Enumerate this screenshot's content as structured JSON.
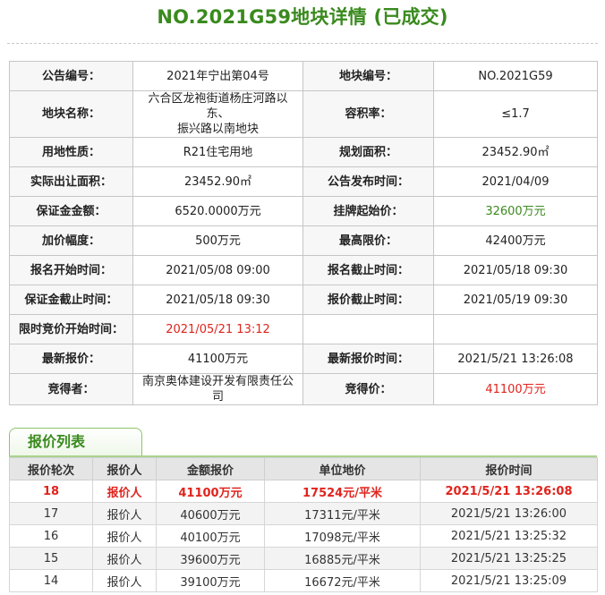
{
  "page_title": "NO.2021G59地块详情 (已成交)",
  "info": {
    "announcement_no_label": "公告编号：",
    "announcement_no": "2021年宁出第04号",
    "plot_no_label": "地块编号：",
    "plot_no": "NO.2021G59",
    "plot_name_label": "地块名称：",
    "plot_name_line1": "六合区龙袍街道杨庄河路以东、",
    "plot_name_line2": "振兴路以南地块",
    "far_label": "容积率：",
    "far": "≤1.7",
    "land_use_label": "用地性质：",
    "land_use": "R21住宅用地",
    "planned_area_label": "规划面积：",
    "planned_area": "23452.90㎡",
    "actual_area_label": "实际出让面积：",
    "actual_area": "23452.90㎡",
    "publish_time_label": "公告发布时间：",
    "publish_time": "2021/04/09",
    "deposit_label": "保证金金额：",
    "deposit": "6520.0000万元",
    "start_price_label": "挂牌起始价：",
    "start_price": "32600万元",
    "increment_label": "加价幅度：",
    "increment": "500万元",
    "max_price_label": "最高限价：",
    "max_price": "42400万元",
    "reg_start_label": "报名开始时间：",
    "reg_start": "2021/05/08 09:00",
    "reg_end_label": "报名截止时间：",
    "reg_end": "2021/05/18 09:30",
    "deposit_deadline_label": "保证金截止时间：",
    "deposit_deadline": "2021/05/18 09:30",
    "bid_deadline_label": "报价截止时间：",
    "bid_deadline": "2021/05/19 09:30",
    "timed_start_label": "限时竞价开始时间：",
    "timed_start": "2021/05/21 13:12",
    "latest_bid_label": "最新报价：",
    "latest_bid": "41100万元",
    "latest_bid_time_label": "最新报价时间：",
    "latest_bid_time": "2021/5/21 13:26:08",
    "winner_label": "竞得者：",
    "winner": "南京奥体建设开发有限责任公司",
    "win_price_label": "竞得价：",
    "win_price": "41100万元"
  },
  "bids": {
    "tab_label": "报价列表",
    "headers": [
      "报价轮次",
      "报价人",
      "金额报价",
      "单位地价",
      "报价时间"
    ],
    "rows": [
      [
        "18",
        "报价人",
        "41100万元",
        "17524元/平米",
        "2021/5/21 13:26:08"
      ],
      [
        "17",
        "报价人",
        "40600万元",
        "17311元/平米",
        "2021/5/21 13:26:00"
      ],
      [
        "16",
        "报价人",
        "40100万元",
        "17098元/平米",
        "2021/5/21 13:25:32"
      ],
      [
        "15",
        "报价人",
        "39600万元",
        "16885元/平米",
        "2021/5/21 13:25:25"
      ],
      [
        "14",
        "报价人",
        "39100万元",
        "16672元/平米",
        "2021/5/21 13:25:09"
      ]
    ]
  },
  "colors": {
    "title_green": "#3a8a1e",
    "highlight_red": "#e0231c",
    "label_bg": "#f7f7f7",
    "header_bg": "#e5e5e5"
  }
}
